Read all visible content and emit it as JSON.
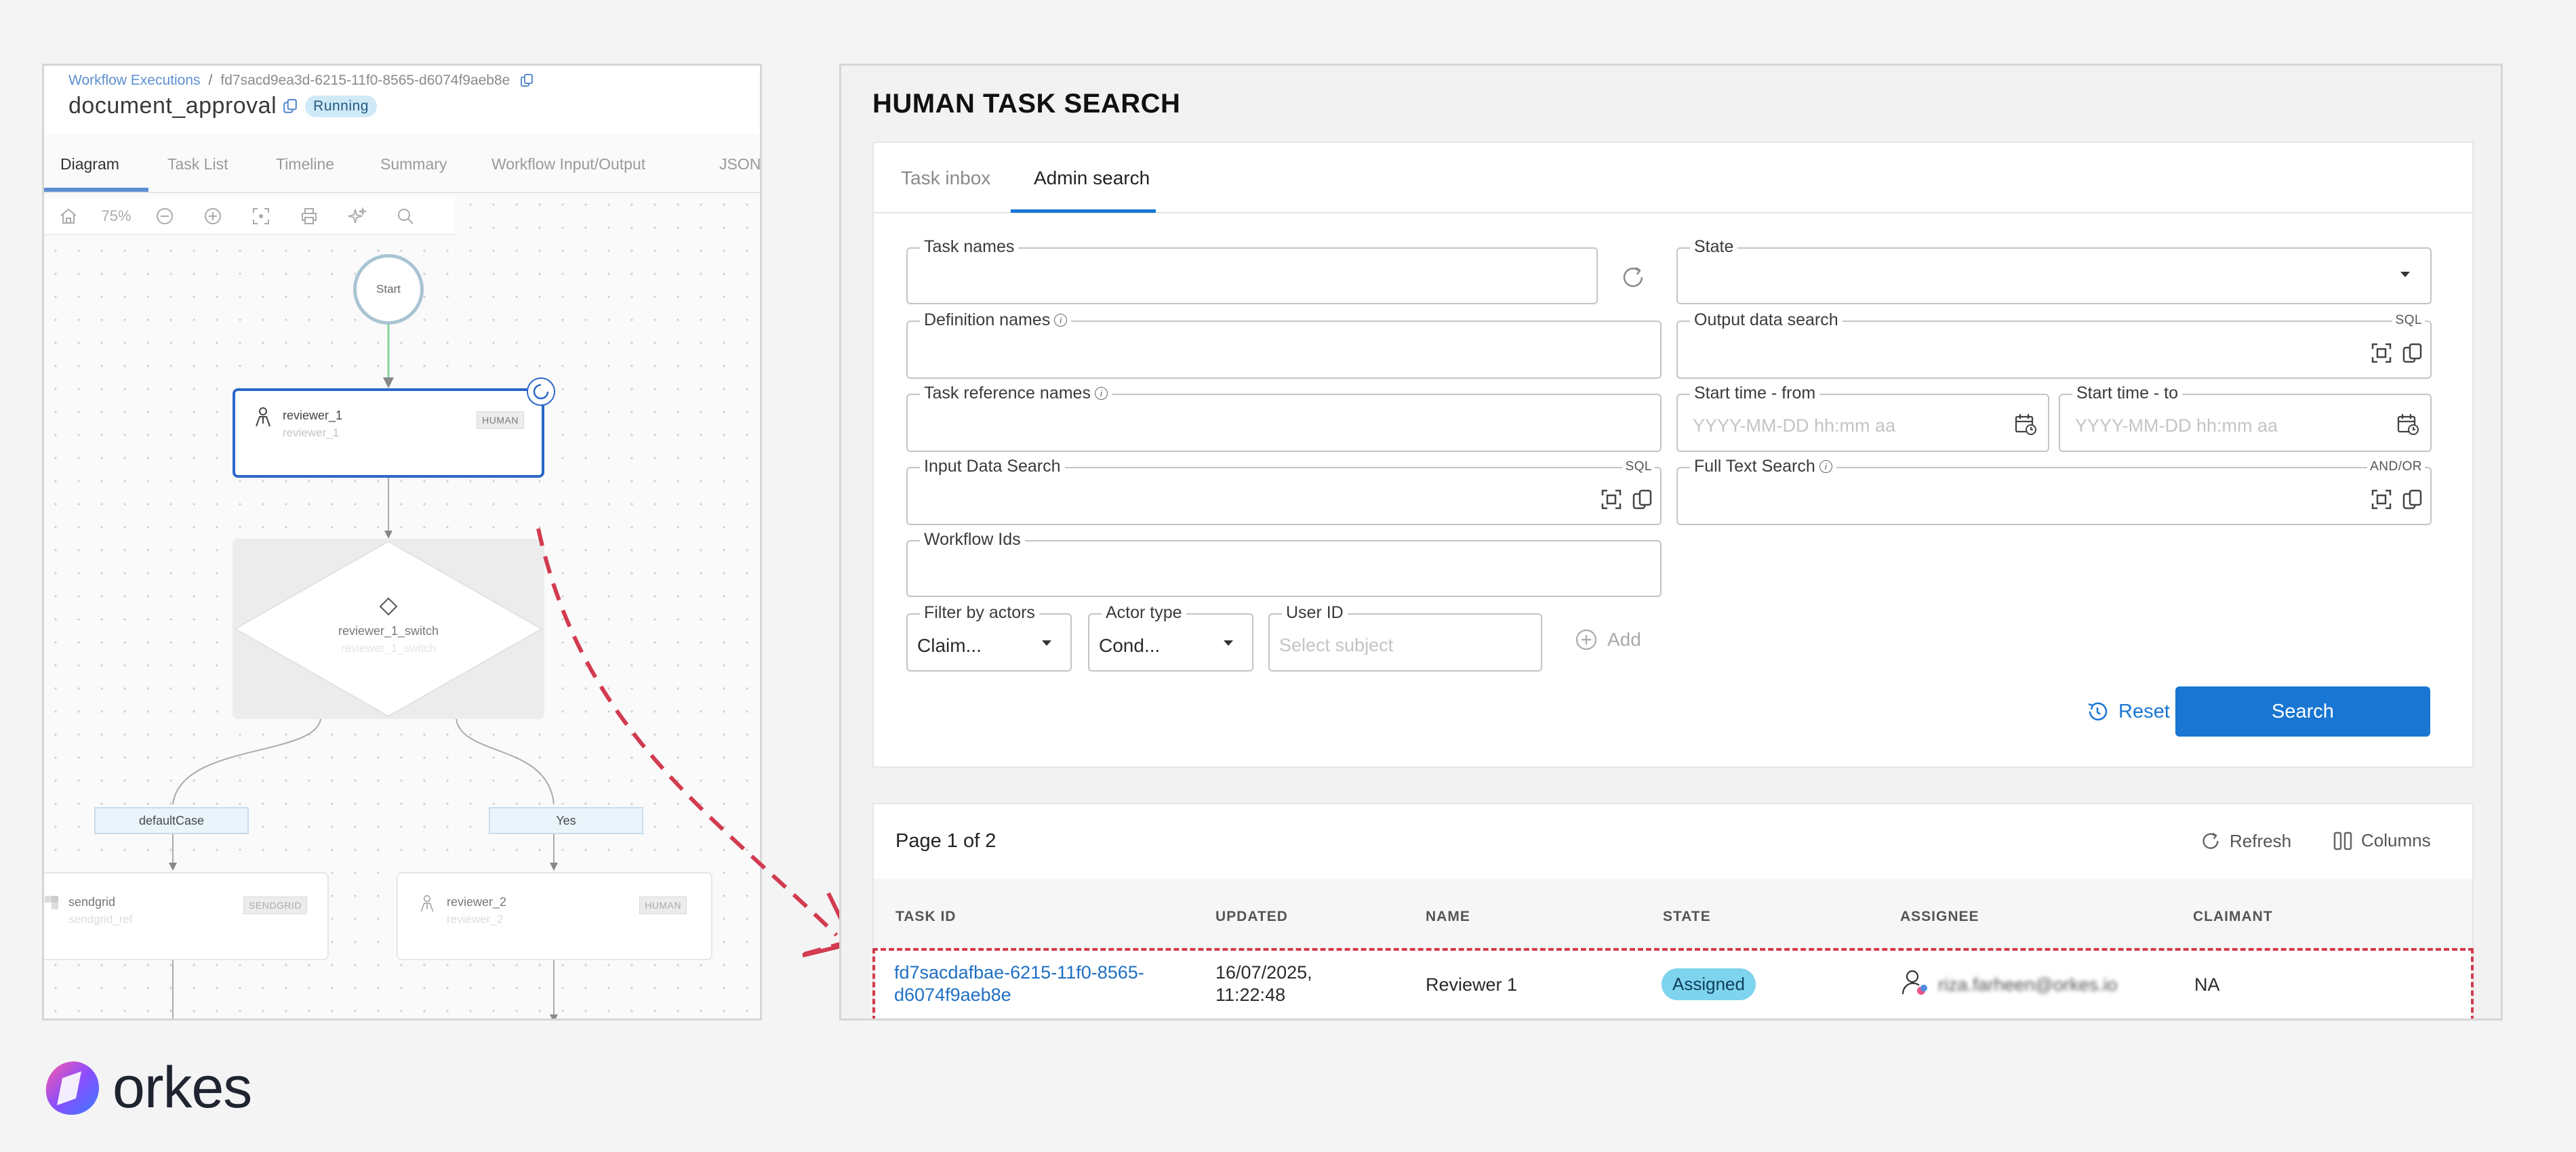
{
  "left": {
    "breadcrumb": {
      "link": "Workflow Executions",
      "separator": "/",
      "id": "fd7sacd9ea3d-6215-11f0-8565-d6074f9aeb8e"
    },
    "workflow_name": "document_approval",
    "status": "Running",
    "tabs": [
      "Diagram",
      "Task List",
      "Timeline",
      "Summary",
      "Workflow Input/Output",
      "JSON"
    ],
    "active_tab": "Diagram",
    "zoom": "75%",
    "nodes": {
      "start": "Start",
      "reviewer1": {
        "title": "reviewer_1",
        "sub": "reviewer_1",
        "tag": "HUMAN"
      },
      "switch": {
        "title": "reviewer_1_switch",
        "sub": "reviewer_1_switch"
      },
      "case_default": "defaultCase",
      "case_yes": "Yes",
      "sendgrid": {
        "title": "sendgrid",
        "sub": "sendgrid_ref",
        "tag": "SENDGRID"
      },
      "reviewer2": {
        "title": "reviewer_2",
        "sub": "reviewer_2",
        "tag": "HUMAN"
      }
    }
  },
  "right": {
    "title": "HUMAN TASK SEARCH",
    "tabs": [
      "Task inbox",
      "Admin search"
    ],
    "active_tab": "Admin search",
    "form": {
      "task_names": "Task names",
      "state": "State",
      "definition_names": "Definition names",
      "output_data_search": "Output data search",
      "sql": "SQL",
      "task_reference_names": "Task reference names",
      "start_from": "Start time - from",
      "start_to": "Start time - to",
      "date_placeholder": "YYYY-MM-DD hh:mm aa",
      "input_data_search": "Input Data Search",
      "full_text_search": "Full Text Search",
      "and_or": "AND/OR",
      "workflow_ids": "Workflow Ids",
      "filter_by_actors": "Filter by actors",
      "filter_by_actors_value": "Claim...",
      "actor_type": "Actor type",
      "actor_type_value": "Cond...",
      "user_id": "User ID",
      "user_id_placeholder": "Select subject",
      "add": "Add",
      "reset": "Reset",
      "search": "Search"
    },
    "results": {
      "page": "Page 1 of 2",
      "refresh": "Refresh",
      "columns": "Columns",
      "headers": [
        "TASK ID",
        "UPDATED",
        "NAME",
        "STATE",
        "ASSIGNEE",
        "CLAIMANT"
      ],
      "row": {
        "task_id_1": "fd7sacdafbae-6215-11f0-8565-",
        "task_id_2": "d6074f9aeb8e",
        "updated_1": "16/07/2025,",
        "updated_2": "11:22:48",
        "name": "Reviewer 1",
        "state": "Assigned",
        "assignee": "riza.farheen@orkes.io",
        "claimant": "NA"
      }
    }
  },
  "brand": {
    "logo_text": "orkes"
  },
  "colors": {
    "accent": "#1976d2",
    "highlight": "#d23b50",
    "node_selected": "#2b67c9"
  }
}
